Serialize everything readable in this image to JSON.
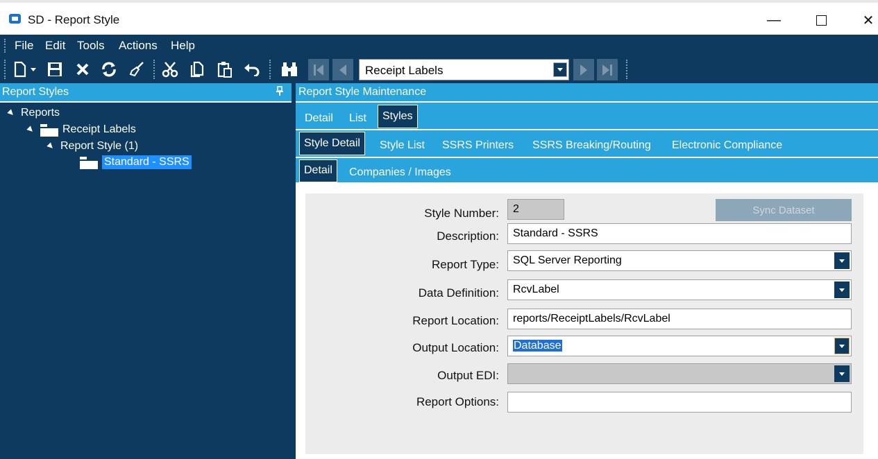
{
  "window": {
    "title": "SD - Report Style",
    "minimize_glyph": "—",
    "close_glyph": "✕"
  },
  "menu": {
    "file": "File",
    "edit": "Edit",
    "tools": "Tools",
    "actions": "Actions",
    "help": "Help"
  },
  "toolbar": {
    "icons": {
      "new": "new-document-icon",
      "save": "save-icon",
      "delete": "delete-icon",
      "refresh": "refresh-icon",
      "clear": "broom-icon",
      "cut": "cut-icon",
      "copy": "copy-icon",
      "paste": "paste-icon",
      "undo": "undo-icon",
      "find": "binoculars-icon"
    },
    "record_selector_value": "Receipt Labels"
  },
  "left_panel": {
    "title": "Report Styles",
    "pin_glyph": "📌",
    "tree": {
      "root": "Reports",
      "level1": "Receipt Labels",
      "level2": "Report Style (1)",
      "level3": "Standard - SSRS"
    }
  },
  "right_panel": {
    "title": "Report Style Maintenance",
    "tabs_top": {
      "detail": "Detail",
      "list": "List",
      "styles": "Styles"
    },
    "tabs_second": {
      "style_detail": "Style Detail",
      "style_list": "Style List",
      "ssrs_printers": "SSRS Printers",
      "ssrs_breaking": "SSRS Breaking/Routing",
      "electronic_compliance": "Electronic Compliance"
    },
    "tabs_third": {
      "detail": "Detail",
      "companies_images": "Companies / Images"
    },
    "form": {
      "sync_button": "Sync Dataset",
      "style_number": {
        "label": "Style Number:",
        "value": "2"
      },
      "description": {
        "label": "Description:",
        "value": "Standard - SSRS"
      },
      "report_type": {
        "label": "Report Type:",
        "value": "SQL Server Reporting"
      },
      "data_definition": {
        "label": "Data Definition:",
        "value": "RcvLabel"
      },
      "report_location": {
        "label": "Report Location:",
        "value": "reports/ReceiptLabels/RcvLabel"
      },
      "output_location": {
        "label": "Output Location:",
        "value": "Database"
      },
      "output_edi": {
        "label": "Output EDI:",
        "value": ""
      },
      "report_options": {
        "label": "Report Options:",
        "value": ""
      }
    }
  },
  "colors": {
    "dark_navy": "#0d3a5e",
    "accent_blue": "#2aa4dd",
    "selection_blue": "#1e6fd6"
  }
}
